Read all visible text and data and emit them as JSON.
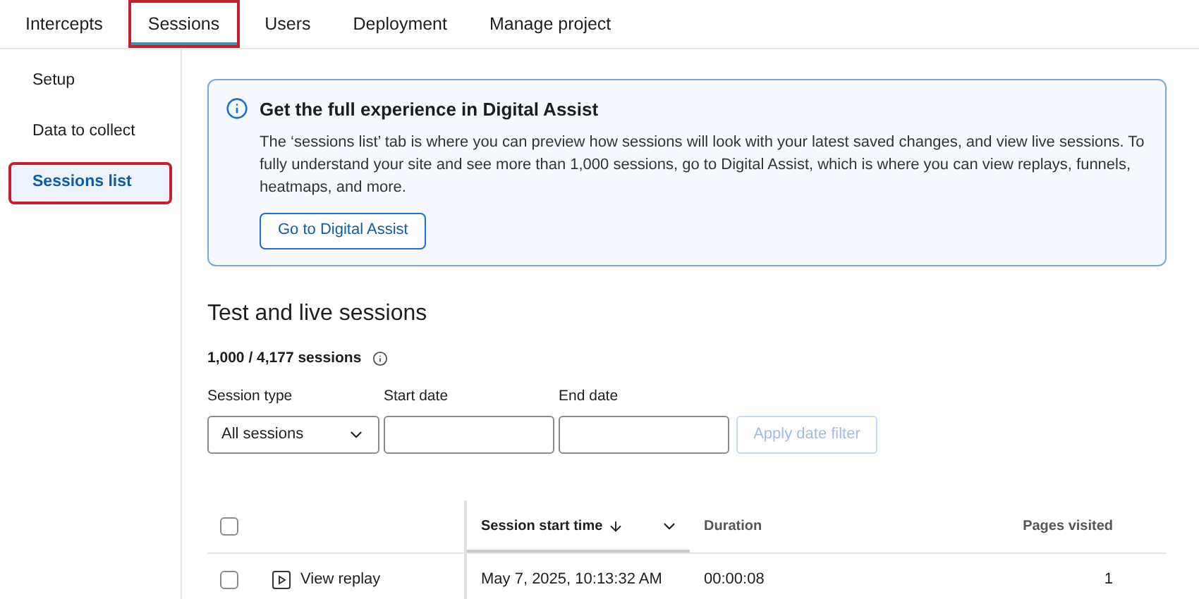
{
  "tabs": [
    {
      "label": "Intercepts",
      "selected": false,
      "highlighted": false
    },
    {
      "label": "Sessions",
      "selected": true,
      "highlighted": true
    },
    {
      "label": "Users",
      "selected": false,
      "highlighted": false
    },
    {
      "label": "Deployment",
      "selected": false,
      "highlighted": false
    },
    {
      "label": "Manage project",
      "selected": false,
      "highlighted": false
    }
  ],
  "sidebar": {
    "items": [
      {
        "label": "Setup",
        "selected": false,
        "highlighted": false
      },
      {
        "label": "Data to collect",
        "selected": false,
        "highlighted": false
      },
      {
        "label": "Sessions list",
        "selected": true,
        "highlighted": true
      }
    ]
  },
  "info_banner": {
    "title": "Get the full experience in Digital Assist",
    "text": "The ‘sessions list’ tab is where you can preview how sessions will look with your latest saved changes, and view live sessions. To fully understand your site and see more than 1,000 sessions, go to Digital Assist, which is where you can view replays, funnels, heatmaps, and more.",
    "button": "Go to Digital Assist"
  },
  "section": {
    "title": "Test and live sessions",
    "count": "1,000 / 4,177 sessions"
  },
  "filters": {
    "session_type": {
      "label": "Session type",
      "value": "All sessions"
    },
    "start_date": {
      "label": "Start date"
    },
    "end_date": {
      "label": "End date"
    },
    "apply_button": {
      "label": "Apply date filter",
      "disabled": true
    }
  },
  "table": {
    "columns": [
      {
        "label": "Session start time",
        "sorted": true
      },
      {
        "label": "Duration",
        "sorted": false
      },
      {
        "label": "Pages visited",
        "sorted": false
      }
    ],
    "select_all": {
      "checked": false
    },
    "rows": [
      {
        "checked": false,
        "action": "View replay",
        "start_time": "May 7, 2025, 10:13:32 AM",
        "duration": "00:00:08",
        "pages": "1"
      }
    ]
  }
}
